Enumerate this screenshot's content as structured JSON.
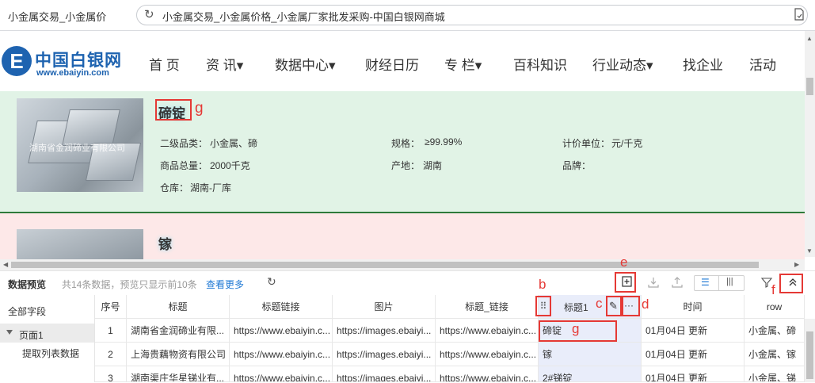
{
  "browser": {
    "tab_title": "小金属交易_小金属价",
    "tab_more": "...",
    "url": "小金属交易_小金属价格_小金属厂家批发采购-中国白银网商城"
  },
  "site": {
    "logo_letter": "E",
    "logo_name": "中国白银网",
    "logo_url": "www.ebaiyin.com",
    "nav": [
      "首 页",
      "资 讯▾",
      "数据中心▾",
      "财经日历",
      "专 栏▾",
      "百科知识",
      "行业动态▾",
      "找企业",
      "活动"
    ]
  },
  "listings": [
    {
      "title": "碲锭",
      "image_watermark": "湖南省金润碲业有限公司",
      "category_label": "二级品类：",
      "category_value": "小金属、碲",
      "spec_label": "规格：",
      "spec_value": "≥99.99%",
      "unit_label": "计价单位：",
      "unit_value": "元/千克",
      "total_label": "商品总量：",
      "total_value": "2000千克",
      "origin_label": "产地：",
      "origin_value": "湖南",
      "brand_label": "品牌：",
      "brand_value": "",
      "warehouse_label": "仓库：",
      "warehouse_value": "湖南-厂库"
    },
    {
      "title": "镓"
    }
  ],
  "annotations": {
    "b": "b",
    "c": "c",
    "d": "d",
    "e": "e",
    "f": "f",
    "g": "g"
  },
  "preview": {
    "title": "数据预览",
    "summary": "共14条数据，预览只显示前10条",
    "more_link": "查看更多",
    "sidebar": {
      "all_fields": "全部字段",
      "page": "页面1",
      "extract": "提取列表数据"
    },
    "columns": [
      "序号",
      "标题",
      "标题链接",
      "图片",
      "标题_链接",
      "⠿",
      "标题1",
      "✎",
      "···",
      "时间",
      "row"
    ],
    "rows": [
      [
        "1",
        "湖南省金润碲业有限...",
        "https://www.ebaiyin.c...",
        "https://images.ebaiyi...",
        "https://www.ebaiyin.c...",
        "碲锭",
        "01月04日 更新",
        "小金属、碲"
      ],
      [
        "2",
        "上海贵藕物资有限公司",
        "https://www.ebaiyin.c...",
        "https://images.ebaiyi...",
        "https://www.ebaiyin.c...",
        "镓",
        "01月04日 更新",
        "小金属、镓"
      ],
      [
        "3",
        "湖南渠庄华星锑业有...",
        "https://www.ebaiyin.c...",
        "https://images.ebaiyi...",
        "https://www.ebaiyin.c...",
        "2#锑锭",
        "01月04日 更新",
        "小金属、锑"
      ]
    ]
  }
}
